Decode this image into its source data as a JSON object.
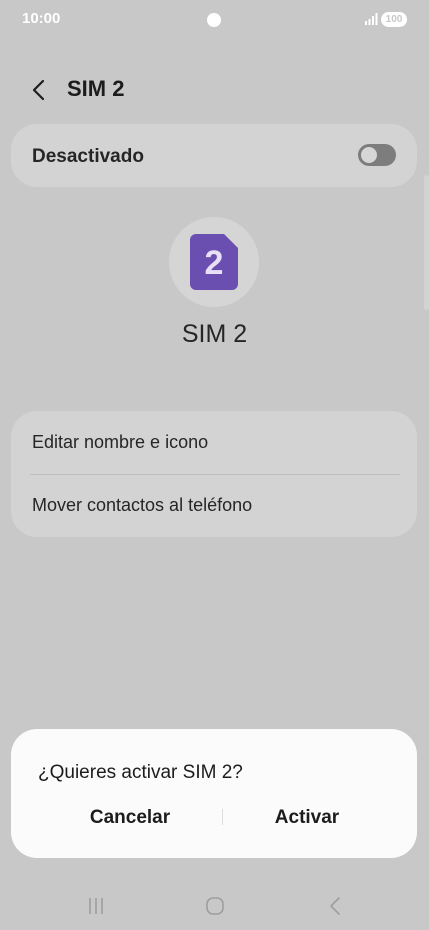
{
  "status_bar": {
    "time": "10:00",
    "battery": "100"
  },
  "header": {
    "title": "SIM 2"
  },
  "toggle": {
    "label": "Desactivado",
    "state": "off"
  },
  "sim": {
    "number": "2",
    "name": "SIM 2",
    "icon_color": "#6b4fb0"
  },
  "options": [
    {
      "label": "Editar nombre e icono"
    },
    {
      "label": "Mover contactos al teléfono"
    }
  ],
  "dialog": {
    "title": "¿Quieres activar SIM 2?",
    "cancel_label": "Cancelar",
    "confirm_label": "Activar"
  },
  "nav": {
    "recents_icon": "recents-icon",
    "home_icon": "home-icon",
    "back_icon": "back-icon"
  }
}
